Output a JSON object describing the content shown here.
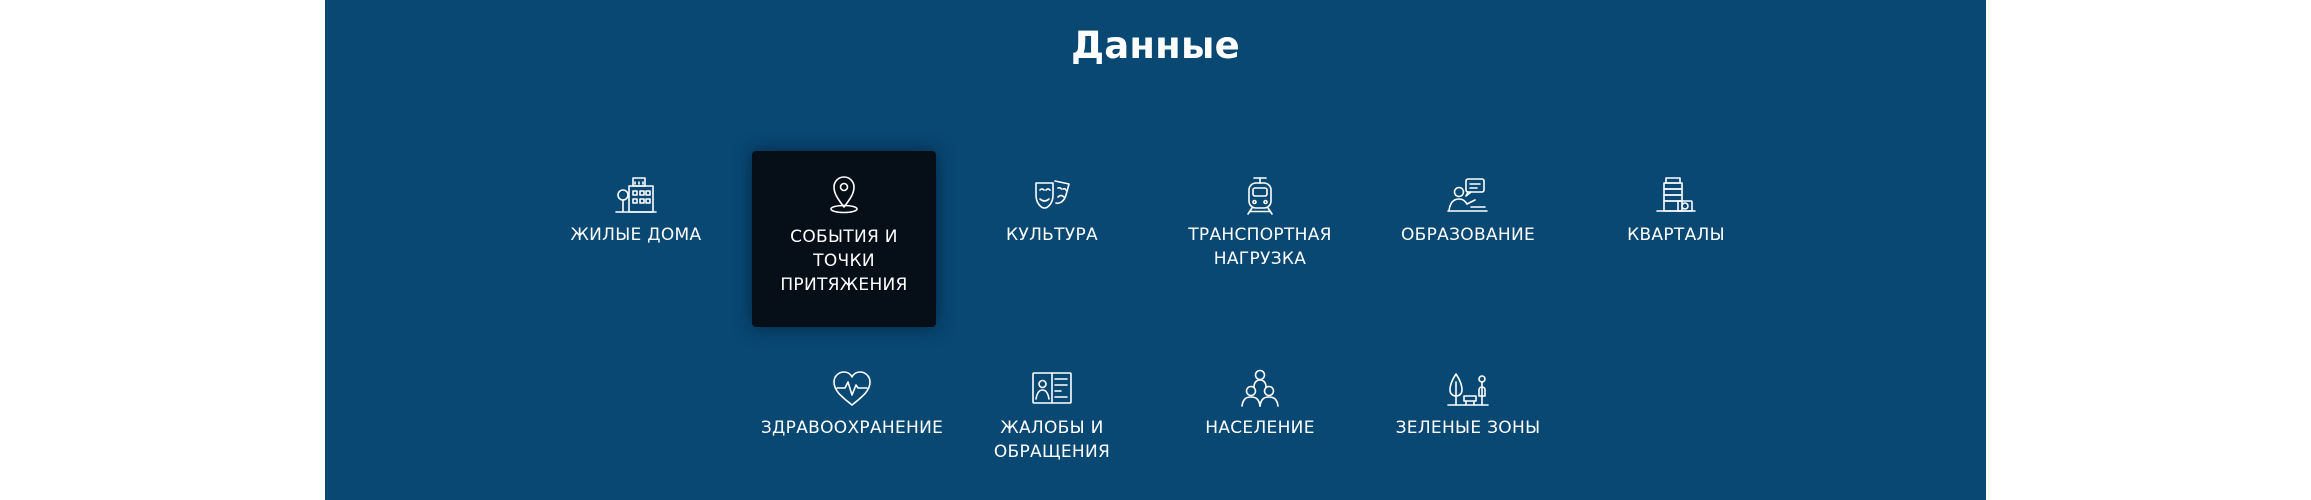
{
  "section": {
    "title": "Данные"
  },
  "tiles": [
    {
      "label": "ЖИЛЫЕ ДОМА",
      "icon": "residential-buildings-icon"
    },
    {
      "label": "СОБЫТИЯ И\nТОЧКИ\nПРИТЯЖЕНИЯ",
      "icon": "location-pin-icon",
      "active": true
    },
    {
      "label": "КУЛЬТУРА",
      "icon": "theater-masks-icon"
    },
    {
      "label": "ТРАНСПОРТНАЯ\nНАГРУЗКА",
      "icon": "tram-icon"
    },
    {
      "label": "ОБРАЗОВАНИЕ",
      "icon": "teacher-icon"
    },
    {
      "label": "КВАРТАЛЫ",
      "icon": "city-blocks-icon"
    },
    {
      "label": "ЗДРАВООХРАНЕНИЕ",
      "icon": "heart-pulse-icon"
    },
    {
      "label": "ЖАЛОБЫ И\nОБРАЩЕНИЯ",
      "icon": "complaint-form-icon"
    },
    {
      "label": "НАСЕЛЕНИЕ",
      "icon": "population-icon"
    },
    {
      "label": "ЗЕЛЕНЫЕ ЗОНЫ",
      "icon": "park-tree-icon"
    }
  ],
  "colors": {
    "panel_bg": "#084873",
    "active_tile_bg": "#060E18",
    "text": "#FFFFFF",
    "page_bg": "#FFFFFF"
  }
}
